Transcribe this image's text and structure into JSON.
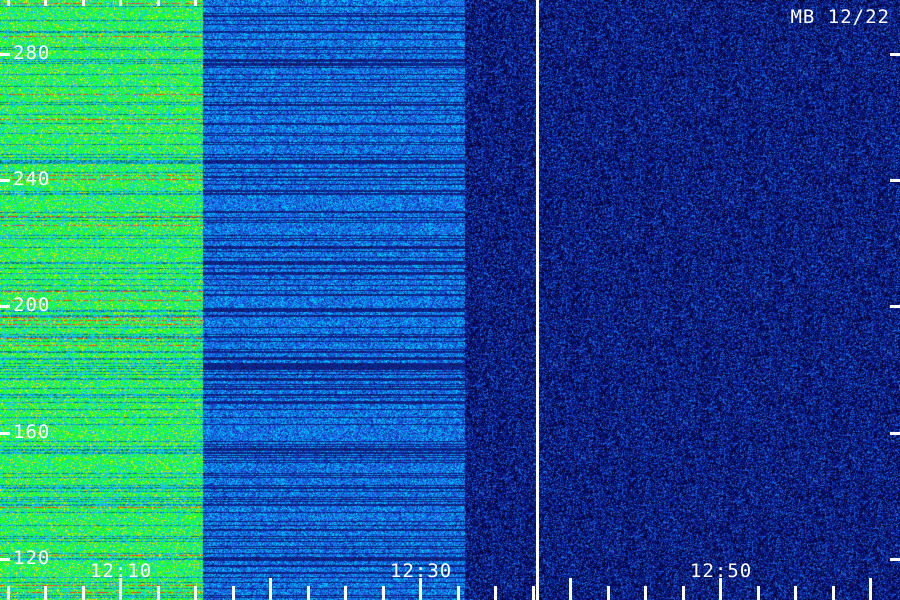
{
  "chart_data": {
    "type": "heatmap",
    "corner_label": "MB 12/22",
    "y_axis": {
      "tick_labels": [
        "280",
        "240",
        "200",
        "160",
        "120"
      ],
      "ticks": [
        280,
        240,
        200,
        160,
        120
      ],
      "range": [
        107,
        297
      ]
    },
    "x_axis": {
      "tick_labels": [
        "12:10",
        "12:30",
        "12:50"
      ],
      "ticks_minutes": [
        730,
        750,
        770
      ],
      "range_minutes": [
        722,
        782
      ]
    },
    "vertical_marker_minute": 757.8,
    "intensity_segments": [
      {
        "from_minute": 722,
        "to_minute": 735.5,
        "level": "high"
      },
      {
        "from_minute": 735.5,
        "to_minute": 753,
        "level": "medium"
      },
      {
        "from_minute": 753,
        "to_minute": 782,
        "level": "low"
      }
    ],
    "colors": {
      "high": "#33ff33",
      "medium": "#1e64e6",
      "low": "#0a1e8c",
      "peak": "#ff3300",
      "marker": "#ffffff"
    }
  }
}
